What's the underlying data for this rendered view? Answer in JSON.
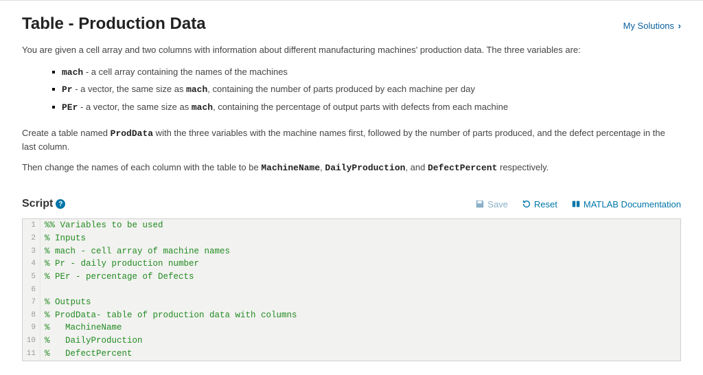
{
  "header": {
    "title": "Table - Production Data",
    "my_solutions": "My Solutions"
  },
  "intro": "You are given a cell array and two columns with information about different manufacturing machines' production data. The three variables are:",
  "vars": [
    {
      "name": "mach",
      "desc": " - a cell array containing the names of the machines"
    },
    {
      "name": "Pr",
      "desc": " - a vector, the same size as ",
      "inline": "mach",
      "desc2": ", containing the number of parts produced by each machine per day"
    },
    {
      "name": "PEr",
      "desc": " - a vector, the same size as ",
      "inline": "mach",
      "desc2": ", containing the percentage of output parts with defects from each machine"
    }
  ],
  "para2_a": "Create a table named ",
  "para2_code": "ProdData",
  "para2_b": " with the three variables with the machine names first, followed by the number of parts produced, and the defect percentage in the last column.",
  "para3_a": "Then change the names of each column with the table to be ",
  "para3_c1": "MachineName",
  "para3_s1": ", ",
  "para3_c2": "DailyProduction",
  "para3_s2": ", and ",
  "para3_c3": "DefectPercent",
  "para3_b": " respectively.",
  "script": {
    "label": "Script",
    "help": "?",
    "save": "Save",
    "reset": "Reset",
    "doc": "MATLAB Documentation"
  },
  "code_lines": [
    "%% Variables to be used",
    "% Inputs",
    "% mach - cell array of machine names",
    "% Pr - daily production number",
    "% PEr - percentage of Defects",
    "",
    "% Outputs",
    "% ProdData- table of production data with columns",
    "%   MachineName",
    "%   DailyProduction",
    "%   DefectPercent"
  ]
}
